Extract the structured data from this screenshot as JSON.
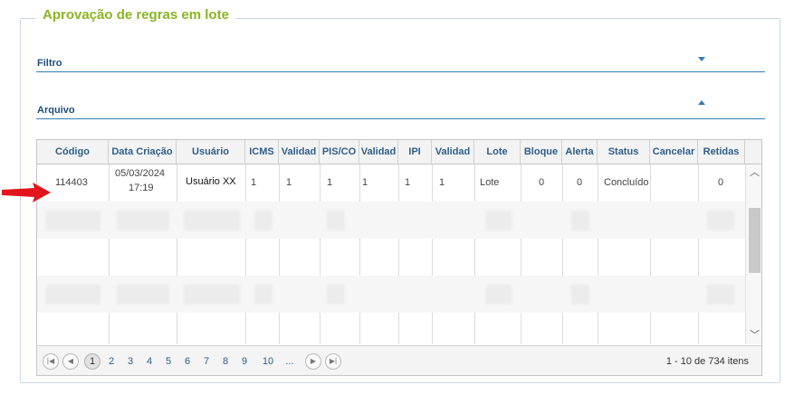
{
  "panel": {
    "title": "Aprovação de regras em lote"
  },
  "sections": {
    "filtro": {
      "label": "Filtro",
      "state": "collapsed"
    },
    "arquivo": {
      "label": "Arquivo",
      "state": "expanded"
    }
  },
  "grid": {
    "columns": [
      "Código",
      "Data Criação",
      "Usuário",
      "ICMS",
      "Validad",
      "PIS/CO",
      "Validad",
      "IPI",
      "Validad",
      "Lote",
      "Bloque",
      "Alerta",
      "Status",
      "Cancelar",
      "Retidas"
    ],
    "rows": [
      {
        "codigo": "114403",
        "data": "05/03/2024",
        "hora": "17:19",
        "usuario": "Usuário XX",
        "icms": "1",
        "validade_icms": "1",
        "pis_cofins": "1",
        "validade_pis": "1",
        "ipi": "1",
        "validade_ipi": "1",
        "lote": "Lote",
        "bloqueio": "0",
        "alerta": "0",
        "status": "Concluído",
        "cancelar": "",
        "retidas": "0"
      }
    ]
  },
  "pager": {
    "pages": [
      "1",
      "2",
      "3",
      "4",
      "5",
      "6",
      "7",
      "8",
      "9",
      "10",
      "..."
    ],
    "current_page": "1",
    "info": "1 - 10 de 734 itens",
    "icons": [
      "first-page-icon",
      "prev-page-icon",
      "next-page-icon",
      "last-page-icon"
    ]
  },
  "colors": {
    "title": "#8ab523",
    "section": "#1f4e79",
    "accent": "#2f7fb5",
    "arrow": "#e3141b"
  }
}
